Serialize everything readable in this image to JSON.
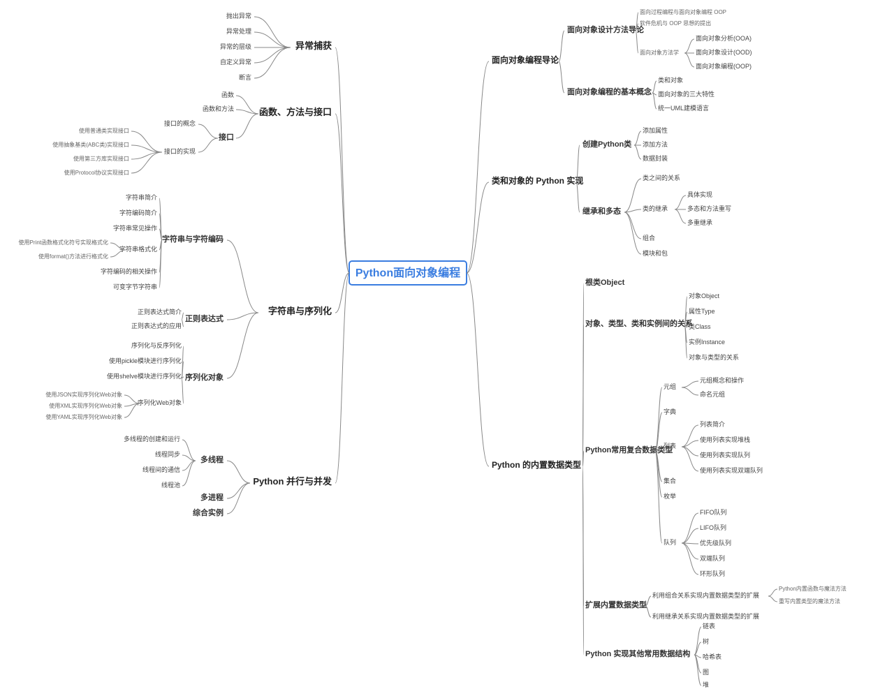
{
  "root": "Python面向对象编程",
  "l1_L": {
    "a": "异常捕获",
    "b": "函数、方法与接口",
    "c": "字符串与序列化",
    "d": "Python 并行与并发"
  },
  "l1_R": {
    "a": "面向对象编程导论",
    "b": "类和对象的 Python 实现",
    "c": "Python 的内置数据类型"
  },
  "exc": [
    "抛出异常",
    "异常处理",
    "异常的层级",
    "自定义异常",
    "断言"
  ],
  "fn": {
    "a": "函数",
    "b": "函数和方法",
    "c": "接口"
  },
  "iface": {
    "a": "接口的概念",
    "b": "接口的实现"
  },
  "ifimpl": [
    "使用普通类实现接口",
    "使用抽象基类(ABC类)实现接口",
    "使用第三方库实现接口",
    "使用Protocol协议实现接口"
  ],
  "sser": {
    "a": "字符串与字符编码",
    "b": "正则表达式",
    "c": "序列化对象"
  },
  "strs": [
    "字符串简介",
    "字符编码简介",
    "字符串常见操作",
    "字符串格式化",
    "字符编码的相关操作",
    "可变字节字符串"
  ],
  "fmt": [
    "使用Print函数格式化符号实现格式化",
    "使用format()方法进行格式化"
  ],
  "regex": [
    "正则表达式简介",
    "正则表达式的应用"
  ],
  "serial": [
    "序列化与反序列化",
    "使用pickle模块进行序列化",
    "使用shelve模块进行序列化",
    "序列化Web对象"
  ],
  "webser": [
    "使用JSON实现序列化Web对象",
    "使用XML实现序列化Web对象",
    "使用YAML实现序列化Web对象"
  ],
  "par": {
    "a": "多线程",
    "b": "多进程",
    "c": "综合实例"
  },
  "thr": [
    "多线程的创建和运行",
    "线程同步",
    "线程间的通信",
    "线程池"
  ],
  "oopi": {
    "a": "面向对象设计方法导论",
    "b": "面向对象编程的基本概念"
  },
  "oopi_a": [
    "面向过程编程与面向对象编程 OOP",
    "软件危机与 OOP 思想的提出",
    "面向对象方法学"
  ],
  "ooms": [
    "面向对象分析(OOA)",
    "面向对象设计(OOD)",
    "面向对象编程(OOP)"
  ],
  "oopi_b": [
    "类和对象",
    "面向对象的三大特性",
    "统一UML建模语言"
  ],
  "clsimpl": {
    "a": "创建Python类",
    "b": "继承和多态"
  },
  "mkclass": [
    "添加属性",
    "添加方法",
    "数据封装"
  ],
  "inh": [
    "类之间的关系",
    "类的继承",
    "组合",
    "模块和包"
  ],
  "inh2": [
    "具体实现",
    "多态和方法重写",
    "多重继承"
  ],
  "dt": {
    "a": "根类Object",
    "b": "对象、类型、类和实例间的关系",
    "c": "Python常用复合数据类型",
    "d": "扩展内置数据类型",
    "e": "Python 实现其他常用数据结构"
  },
  "rel": [
    "对象Object",
    "属性Type",
    "类Class",
    "实例Instance",
    "对象与类型的关系"
  ],
  "comp": [
    "元组",
    "字典",
    "列表",
    "集合",
    "枚举",
    "队列"
  ],
  "tuple": [
    "元组概念和操作",
    "命名元组"
  ],
  "list": [
    "列表简介",
    "使用列表实现堆栈",
    "使用列表实现队列",
    "使用列表实现双端队列"
  ],
  "queue": [
    "FIFO队列",
    "LIFO队列",
    "优先级队列",
    "双端队列",
    "环形队列"
  ],
  "ext": [
    "利用组合关系实现内置数据类型的扩展",
    "利用继承关系实现内置数据类型的扩展"
  ],
  "ext2": [
    "Python内置函数与魔法方法",
    "重写内置类型的魔法方法"
  ],
  "other": [
    "链表",
    "树",
    "哈希表",
    "图",
    "堆"
  ]
}
